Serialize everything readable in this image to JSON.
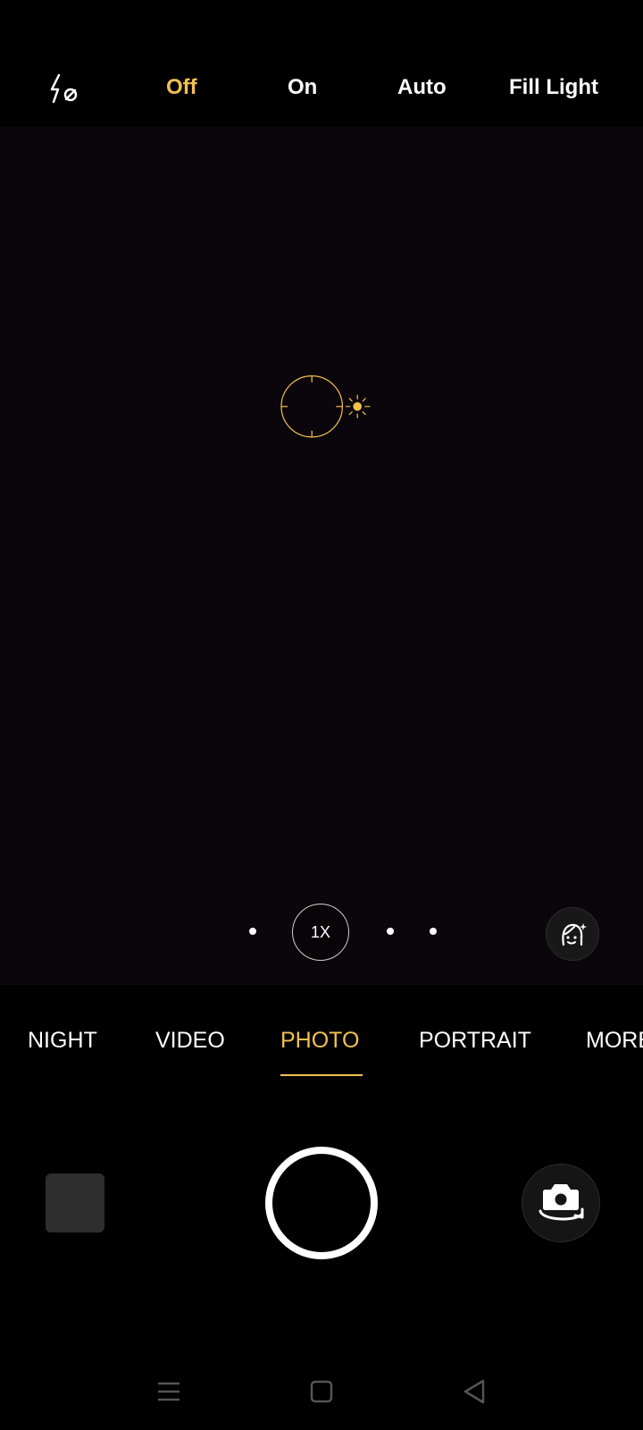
{
  "flash": {
    "icon": "flash-off-icon",
    "options": [
      "Off",
      "On",
      "Auto",
      "Fill Light"
    ],
    "selected": "Off"
  },
  "viewfinder": {
    "focus_icon": "focus-ring-icon",
    "exposure_icon": "sun-exposure-icon",
    "zoom_label": "1X",
    "beauty_icon": "beauty-face-icon"
  },
  "modes": {
    "items": [
      "NIGHT",
      "VIDEO",
      "PHOTO",
      "PORTRAIT",
      "MORE"
    ],
    "selected": "PHOTO"
  },
  "controls": {
    "gallery_icon": "gallery-thumbnail",
    "shutter_icon": "shutter-button",
    "switch_icon": "switch-camera-icon"
  },
  "nav": {
    "icons": [
      "menu-icon",
      "home-icon",
      "back-icon"
    ]
  },
  "colors": {
    "accent": "#F2C14E",
    "text": "#FFFFFF",
    "background": "#000000",
    "viewfinder": "#0B060B"
  }
}
